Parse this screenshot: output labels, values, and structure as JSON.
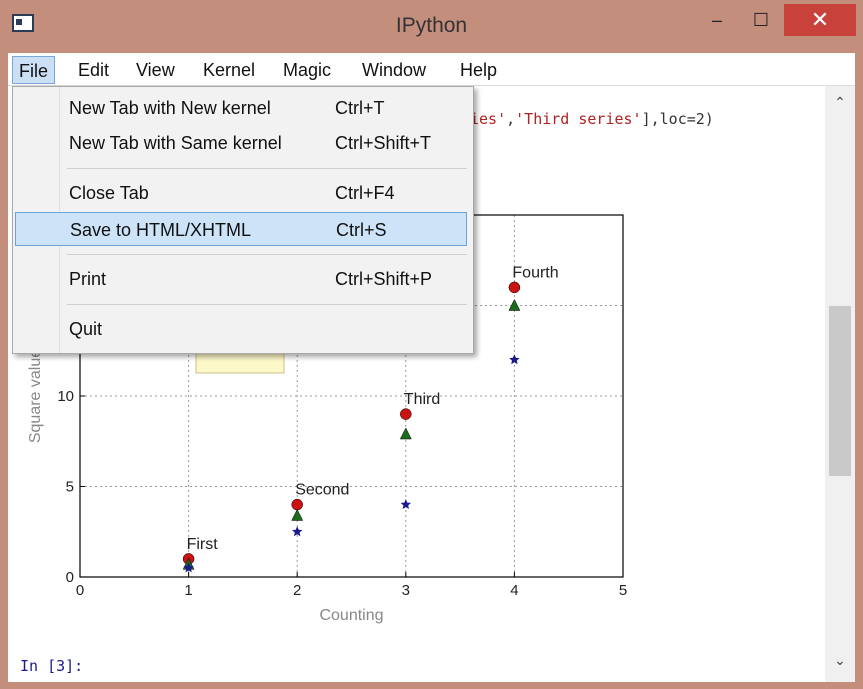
{
  "window": {
    "title": "IPython",
    "minimize": "–",
    "maximize": "☐",
    "close": "✕",
    "colors": {
      "frame": "#c48e7c",
      "close": "#c8413b"
    }
  },
  "menu": [
    "File",
    "Edit",
    "View",
    "Kernel",
    "Magic",
    "Window",
    "Help"
  ],
  "file_menu": [
    {
      "label": "New Tab with New kernel",
      "shortcut": "Ctrl+T"
    },
    {
      "label": "New Tab with Same kernel",
      "shortcut": "Ctrl+Shift+T"
    },
    {
      "label": "Close Tab",
      "shortcut": "Ctrl+F4"
    },
    {
      "label": "Save to HTML/XHTML",
      "shortcut": "Ctrl+S"
    },
    {
      "label": "Print",
      "shortcut": "Ctrl+Shift+P"
    },
    {
      "label": "Quit",
      "shortcut": ""
    }
  ],
  "code": {
    "pre": "ies'",
    "comma": ",",
    "str2": "'Third series'",
    "post": "],loc=2)"
  },
  "prompt": "In [3]:",
  "chart_data": {
    "type": "scatter",
    "xlabel": "Counting",
    "ylabel": "Square value",
    "xlim": [
      0,
      5
    ],
    "ylim": [
      0,
      20
    ],
    "xticks": [
      0,
      1,
      2,
      3,
      4,
      5
    ],
    "yticks": [
      0,
      5,
      10
    ],
    "grid": true,
    "series": [
      {
        "marker": "circle",
        "color": "#cc1111",
        "x": [
          1,
          2,
          3,
          4
        ],
        "y": [
          1,
          4,
          9,
          16
        ]
      },
      {
        "marker": "triangle",
        "color": "#1a6b1a",
        "x": [
          1,
          2,
          3,
          4
        ],
        "y": [
          0.7,
          3.4,
          7.9,
          15
        ]
      },
      {
        "marker": "star",
        "color": "#1a1a8c",
        "x": [
          1,
          2,
          3,
          4
        ],
        "y": [
          0.5,
          2.5,
          4,
          12
        ]
      }
    ],
    "annotations": [
      {
        "text": "First",
        "x": 1,
        "y": 1
      },
      {
        "text": "Second",
        "x": 2,
        "y": 4
      },
      {
        "text": "Third",
        "x": 3,
        "y": 9
      },
      {
        "text": "Fourth",
        "x": 4,
        "y": 16
      }
    ]
  }
}
